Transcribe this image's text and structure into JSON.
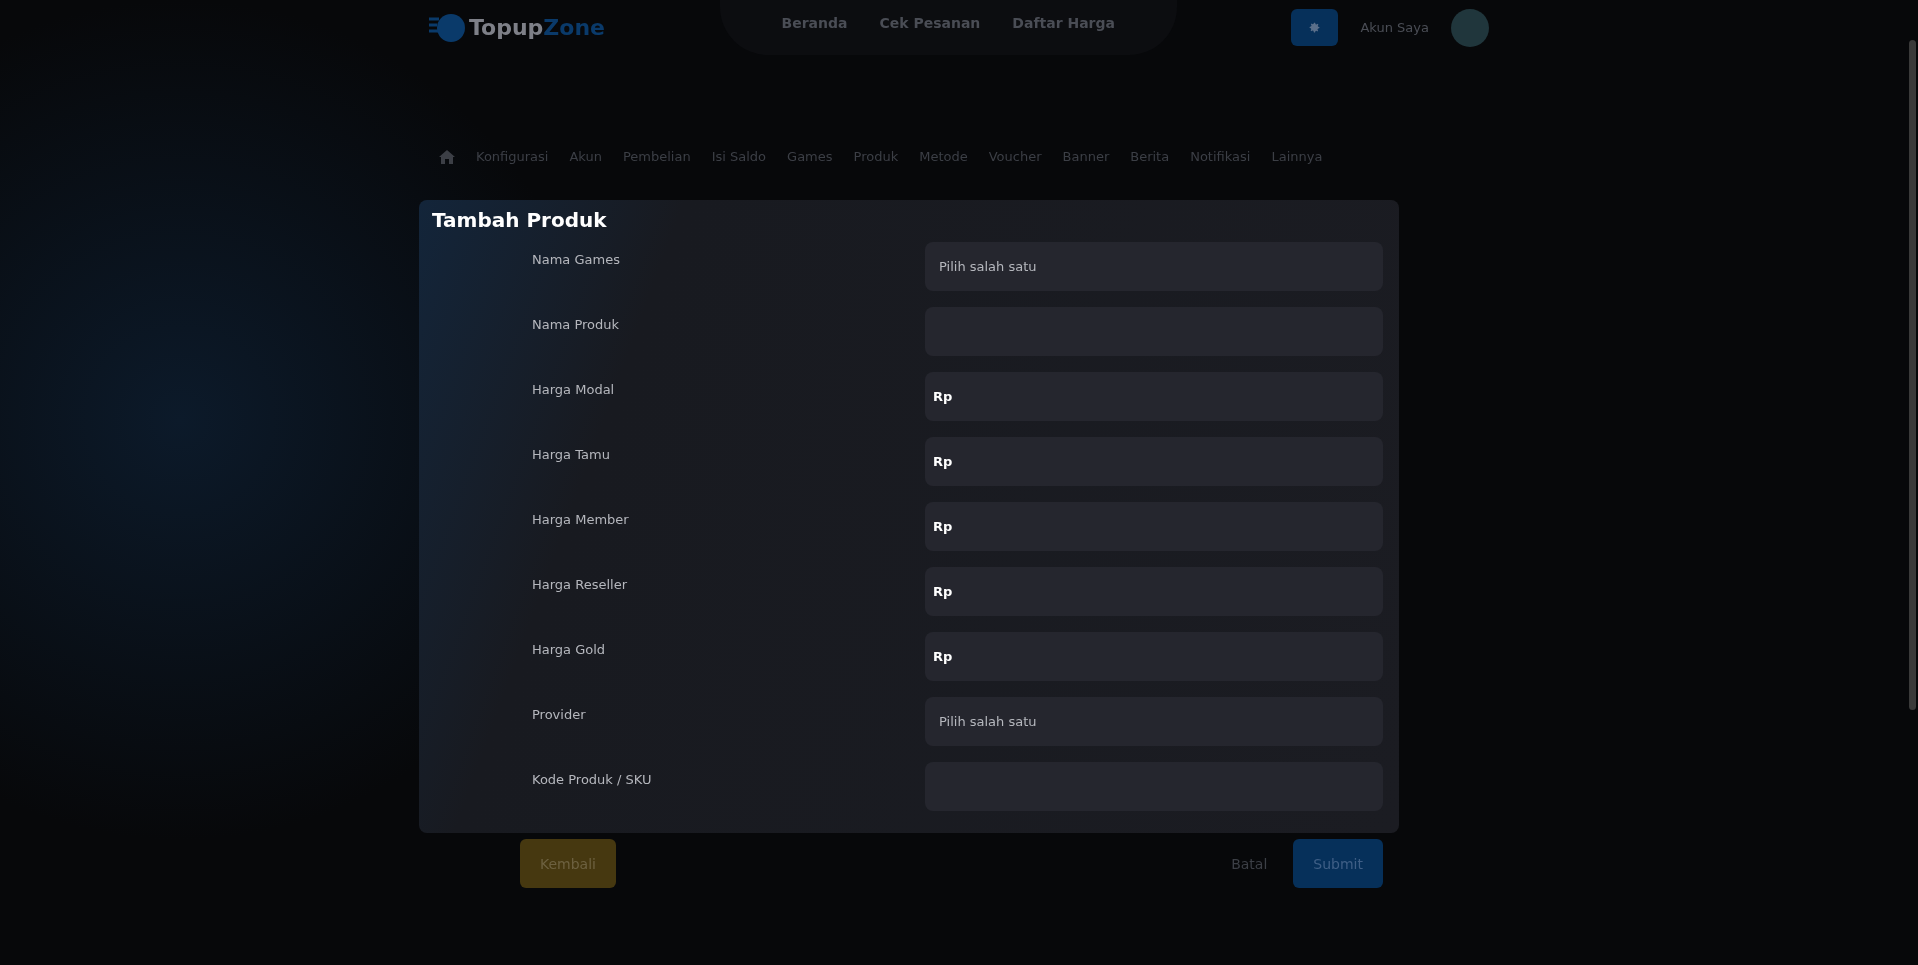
{
  "header": {
    "logo": {
      "first": "Topup",
      "second": "Zone"
    },
    "nav": [
      "Beranda",
      "Cek Pesanan",
      "Daftar Harga"
    ],
    "account": "Akun Saya"
  },
  "admin_tabs": [
    "Konfigurasi",
    "Akun",
    "Pembelian",
    "Isi Saldo",
    "Games",
    "Produk",
    "Metode",
    "Voucher",
    "Banner",
    "Berita",
    "Notifikasi",
    "Lainnya"
  ],
  "form": {
    "title": "Tambah Produk",
    "fields": [
      {
        "label": "Nama Games",
        "kind": "select",
        "placeholder": "Pilih salah satu"
      },
      {
        "label": "Nama Produk",
        "kind": "text"
      },
      {
        "label": "Harga Modal",
        "kind": "currency",
        "prefix": "Rp"
      },
      {
        "label": "Harga Tamu",
        "kind": "currency",
        "prefix": "Rp"
      },
      {
        "label": "Harga Member",
        "kind": "currency",
        "prefix": "Rp"
      },
      {
        "label": "Harga Reseller",
        "kind": "currency",
        "prefix": "Rp"
      },
      {
        "label": "Harga Gold",
        "kind": "currency",
        "prefix": "Rp"
      },
      {
        "label": "Provider",
        "kind": "select",
        "placeholder": "Pilih salah satu"
      },
      {
        "label": "Kode Produk / SKU",
        "kind": "text"
      }
    ]
  },
  "buttons": {
    "back": "Kembali",
    "cancel": "Batal",
    "submit": "Submit"
  }
}
